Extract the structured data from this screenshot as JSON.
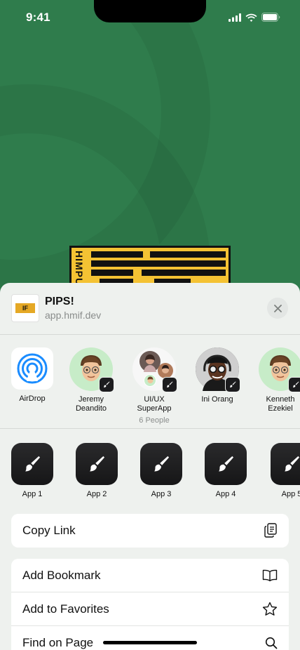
{
  "status_bar": {
    "time": "9:41"
  },
  "poster": {
    "text": "HIMPU"
  },
  "share_sheet": {
    "title": "PIPS!",
    "url": "app.hmif.dev",
    "thumb_text": "IF"
  },
  "people": [
    {
      "name": "AirDrop",
      "sub": ""
    },
    {
      "name": "Jeremy\nDeandito",
      "sub": ""
    },
    {
      "name": "UI/UX\nSuperApp",
      "sub": "6 People"
    },
    {
      "name": "Ini Orang",
      "sub": ""
    },
    {
      "name": "Kenneth\nEzekiel",
      "sub": ""
    }
  ],
  "apps": [
    {
      "label": "App 1"
    },
    {
      "label": "App 2"
    },
    {
      "label": "App 3"
    },
    {
      "label": "App 4"
    },
    {
      "label": "App 5"
    }
  ],
  "actions": {
    "copy_link": "Copy Link",
    "add_bookmark": "Add Bookmark",
    "add_favorites": "Add to Favorites",
    "find_on_page": "Find on Page"
  },
  "icons": {
    "signal": "signal-icon",
    "wifi": "wifi-icon",
    "battery": "battery-icon",
    "close": "close-icon",
    "airdrop": "airdrop-icon",
    "app": "paintbrush-icon",
    "copy": "copy-icon",
    "bookmark": "book-icon",
    "favorite": "star-icon",
    "search": "search-icon"
  }
}
